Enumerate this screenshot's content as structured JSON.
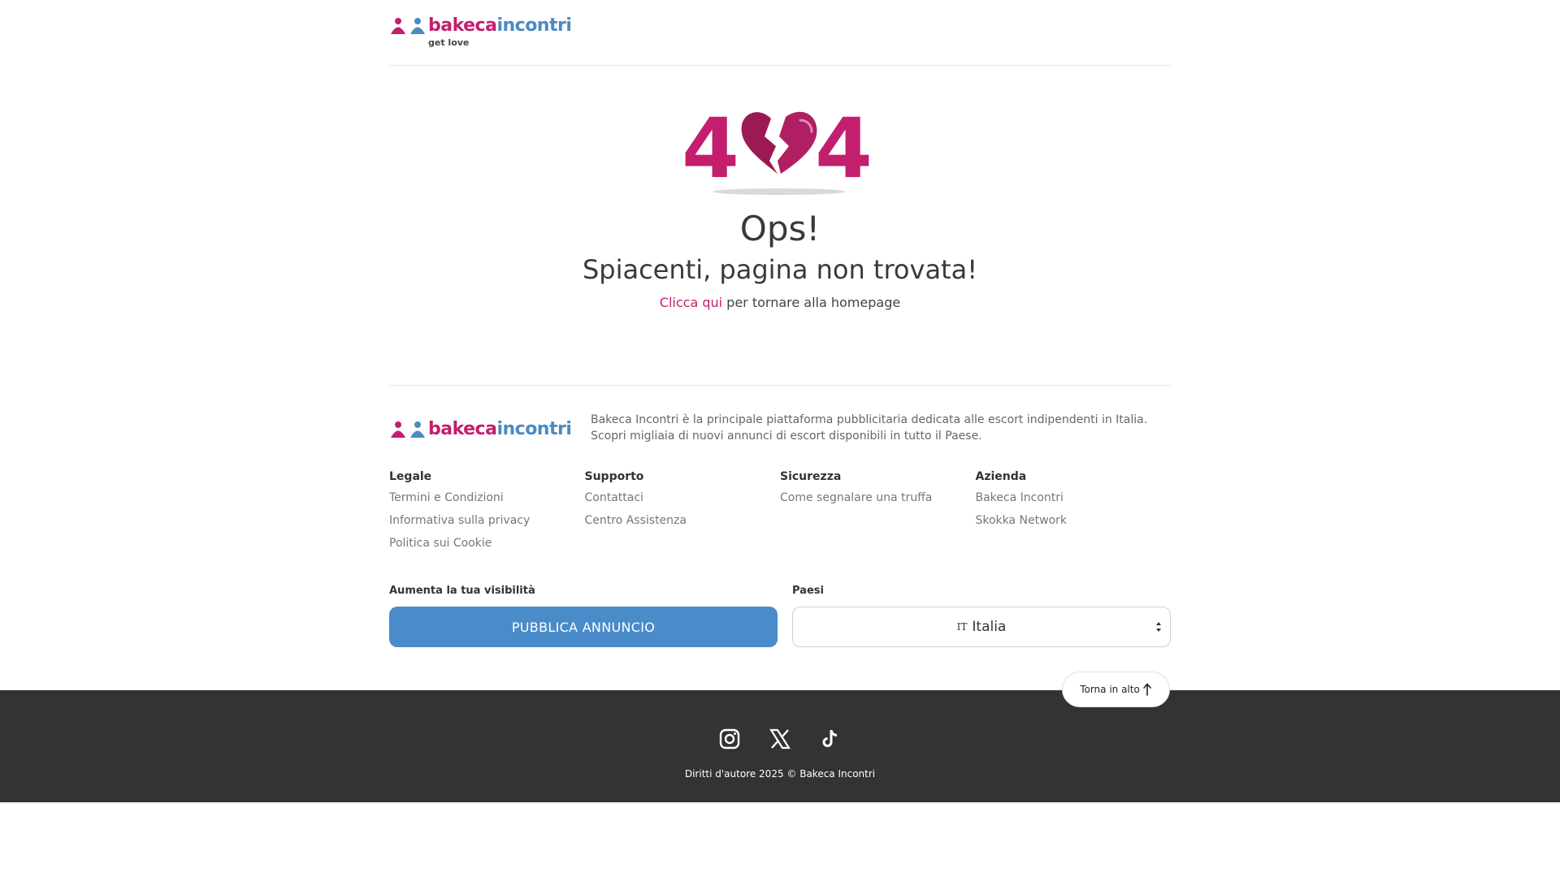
{
  "brand": {
    "name_part1": "bakeca",
    "name_part2": "incontri",
    "tagline": "get love",
    "colors": {
      "pink": "#c41e6e",
      "blue": "#4a8bc4"
    }
  },
  "error": {
    "code_left": "4",
    "code_right": "4",
    "title": "Ops!",
    "subtitle": "Spiacenti, pagina non trovata!",
    "link_text": "Clicca qui",
    "link_suffix": " per tornare alla homepage"
  },
  "footer": {
    "description": "Bakeca Incontri è la principale piattaforma pubblicitaria dedicata alle escort indipendenti in Italia. Scopri migliaia di nuovi annunci di escort disponibili in tutto il Paese.",
    "columns": [
      {
        "heading": "Legale",
        "links": [
          "Termini e Condizioni",
          "Informativa sulla privacy",
          "Politica sui Cookie"
        ]
      },
      {
        "heading": "Supporto",
        "links": [
          "Contattaci",
          "Centro Assistenza"
        ]
      },
      {
        "heading": "Sicurezza",
        "links": [
          "Come segnalare una truffa"
        ]
      },
      {
        "heading": "Azienda",
        "links": [
          "Bakeca Incontri",
          "Skokka Network"
        ]
      }
    ],
    "visibility_label": "Aumenta la tua visibilità",
    "publish_label": "PUBBLICA ANNUNCIO",
    "countries_label": "Paesi",
    "country_flag": "IT",
    "country_selected": "Italia",
    "back_to_top": "Torna in alto",
    "socials": [
      "instagram-icon",
      "x-icon",
      "tiktok-icon"
    ],
    "copyright": "Diritti d'autore 2025 © Bakeca Incontri"
  }
}
